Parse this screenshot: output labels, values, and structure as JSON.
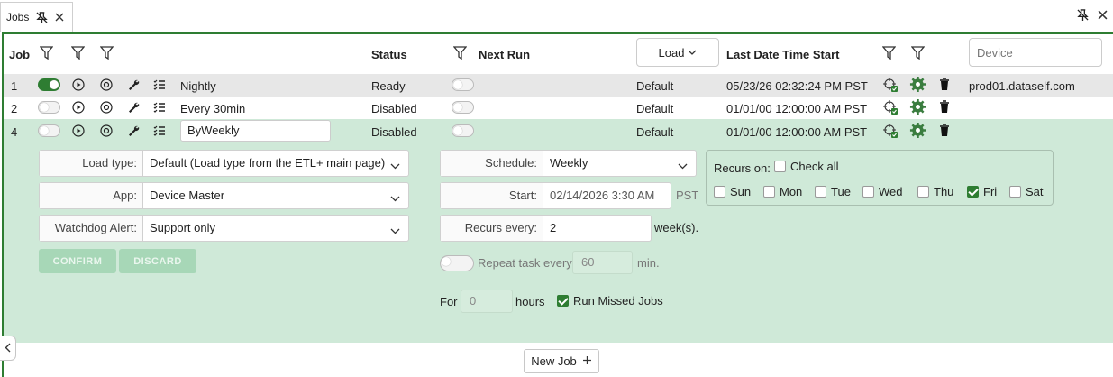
{
  "tab": {
    "title": "Jobs"
  },
  "header": {
    "job": "Job",
    "status": "Status",
    "next_run": "Next Run",
    "load_button": "Load",
    "last_start": "Last Date Time Start",
    "device_placeholder": "Device"
  },
  "rows": [
    {
      "num": "1",
      "enabled": true,
      "name": "Nightly",
      "status": "Ready",
      "load": "Default",
      "last": "05/23/26 02:32:24 PM PST",
      "device": "prod01.dataself.com"
    },
    {
      "num": "2",
      "enabled": false,
      "name": "Every 30min",
      "status": "Disabled",
      "load": "Default",
      "last": "01/01/00 12:00:00 AM PST",
      "device": ""
    },
    {
      "num": "4",
      "enabled": false,
      "name": "ByWeekly",
      "status": "Disabled",
      "load": "Default",
      "last": "01/01/00 12:00:00 AM PST",
      "device": ""
    }
  ],
  "editor": {
    "load_type_label": "Load type:",
    "load_type_value": "Default (Load type from the ETL+ main page)",
    "app_label": "App:",
    "app_value": "Device Master",
    "watchdog_label": "Watchdog Alert:",
    "watchdog_value": "Support only",
    "confirm": "CONFIRM",
    "discard": "DISCARD",
    "schedule_label": "Schedule:",
    "schedule_value": "Weekly",
    "start_label": "Start:",
    "start_value": "02/14/2026 3:30 AM",
    "start_tz": "PST",
    "recurs_every_label": "Recurs every:",
    "recurs_every_value": "2",
    "recurs_unit": "week(s).",
    "repeat_label": "Repeat task every",
    "repeat_value": "60",
    "repeat_unit": "min.",
    "for_label": "For",
    "for_value": "0",
    "for_unit": "hours",
    "run_missed_label": "Run Missed Jobs",
    "recurs_on_label": "Recurs on:",
    "check_all_label": "Check all",
    "days": [
      {
        "label": "Sun",
        "checked": false
      },
      {
        "label": "Mon",
        "checked": false
      },
      {
        "label": "Tue",
        "checked": false
      },
      {
        "label": "Wed",
        "checked": false
      },
      {
        "label": "Thu",
        "checked": false
      },
      {
        "label": "Fri",
        "checked": true
      },
      {
        "label": "Sat",
        "checked": false
      }
    ]
  },
  "footer": {
    "new_job": "New Job"
  },
  "colors": {
    "accent": "#2e7d32",
    "editor_bg": "#cfe9d8",
    "selected_row": "#e7e7e7"
  }
}
